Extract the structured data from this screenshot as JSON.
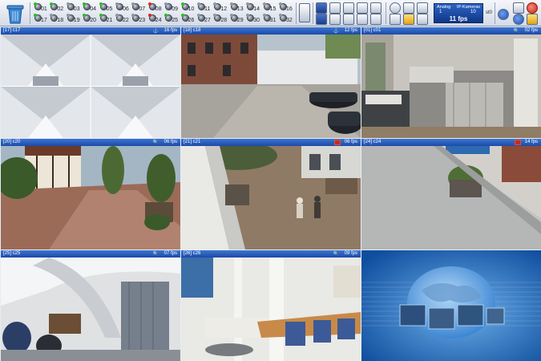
{
  "toolbar": {
    "camera_buttons": [
      {
        "number": "01",
        "status": "active"
      },
      {
        "number": "02",
        "status": "active"
      },
      {
        "number": "03",
        "status": "idle"
      },
      {
        "number": "04",
        "status": "active"
      },
      {
        "number": "05",
        "status": "active"
      },
      {
        "number": "06",
        "status": "idle"
      },
      {
        "number": "07",
        "status": "idle"
      },
      {
        "number": "08",
        "status": "recording"
      },
      {
        "number": "09",
        "status": "idle"
      },
      {
        "number": "10",
        "status": "active"
      },
      {
        "number": "11",
        "status": "idle"
      },
      {
        "number": "12",
        "status": "idle"
      },
      {
        "number": "13",
        "status": "idle"
      },
      {
        "number": "14",
        "status": "idle"
      },
      {
        "number": "15",
        "status": "idle"
      },
      {
        "number": "16",
        "status": "idle"
      },
      {
        "number": "17",
        "status": "active"
      },
      {
        "number": "18",
        "status": "idle"
      },
      {
        "number": "19",
        "status": "idle"
      },
      {
        "number": "20",
        "status": "active"
      },
      {
        "number": "21",
        "status": "active"
      },
      {
        "number": "22",
        "status": "idle"
      },
      {
        "number": "23",
        "status": "idle"
      },
      {
        "number": "24",
        "status": "recording"
      },
      {
        "number": "25",
        "status": "active"
      },
      {
        "number": "26",
        "status": "active"
      },
      {
        "number": "27",
        "status": "idle"
      },
      {
        "number": "28",
        "status": "idle"
      },
      {
        "number": "29",
        "status": "idle"
      },
      {
        "number": "30",
        "status": "idle"
      },
      {
        "number": "31",
        "status": "idle"
      },
      {
        "number": "32",
        "status": "idle"
      }
    ],
    "status_colors": {
      "active": "#22c31f",
      "recording": "#e0261c",
      "idle": "#8d96a6"
    },
    "analog_label": "Analog",
    "analog_count": "1",
    "ip_label": "IP-Kameras",
    "ip_count": "10",
    "total_fps": "11 fps",
    "mode_label": "st0"
  },
  "cameras": [
    {
      "title": "[17] c17",
      "fps": "16 fps",
      "recording": false
    },
    {
      "title": "[18] c18",
      "fps": "12 fps",
      "recording": false
    },
    {
      "title": "[01] c01",
      "fps": "02 fps",
      "recording": false
    },
    {
      "title": "[20] c20",
      "fps": "06 fps",
      "recording": false
    },
    {
      "title": "[21] c21",
      "fps": "06 fps",
      "recording": true
    },
    {
      "title": "[24] c24",
      "fps": "14 fps",
      "recording": true
    },
    {
      "title": "[25] c25",
      "fps": "07 fps",
      "recording": false
    },
    {
      "title": "[26] c26",
      "fps": "09 fps",
      "recording": false
    }
  ],
  "colors": {
    "accent": "#1c4aa8",
    "toolbar": "#d5dbe6",
    "logo_tile": "#1d61b4"
  }
}
